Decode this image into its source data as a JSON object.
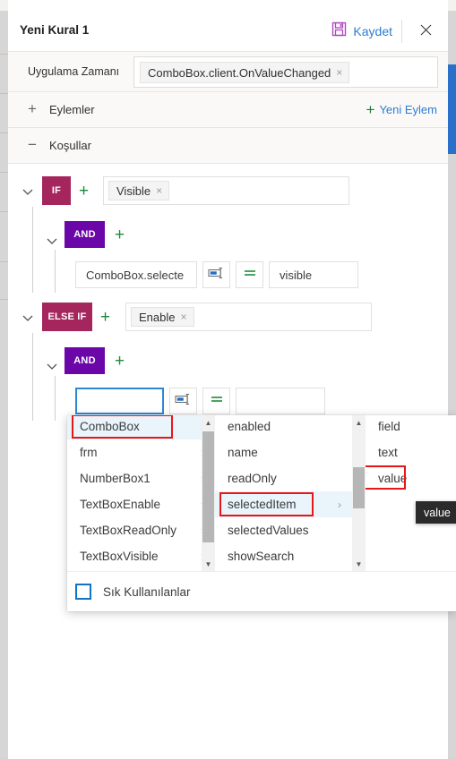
{
  "header": {
    "title": "Yeni Kural 1",
    "save_label": "Kaydet",
    "save_icon": "save-floppy-icon",
    "close_icon": "close-icon"
  },
  "trigger": {
    "label": "Uygulama Zamanı",
    "pill": "ComboBox.client.OnValueChanged",
    "pill_remove": "×"
  },
  "sections": {
    "actions": {
      "toggle": "+",
      "label": "Eylemler",
      "add_icon": "plus-icon",
      "add_label": "Yeni Eylem"
    },
    "conditions": {
      "toggle": "−",
      "label": "Koşullar"
    }
  },
  "conditions": {
    "branches": [
      {
        "badge": "IF",
        "badge_color": "#a4265c",
        "add": "+",
        "pill": "Visible",
        "pill_remove": "×",
        "group": {
          "badge": "AND",
          "badge_color": "#6b07a8",
          "add": "+",
          "rows": [
            {
              "left": "ComboBox.selecte",
              "op_icon": "textfield-cursor-icon",
              "comparator": "=",
              "right": "visible",
              "focused": false
            }
          ]
        }
      },
      {
        "badge": "ELSE IF",
        "badge_color": "#a4265c",
        "add": "+",
        "pill": "Enable",
        "pill_remove": "×",
        "group": {
          "badge": "AND",
          "badge_color": "#6b07a8",
          "add": "+",
          "rows": [
            {
              "left": "",
              "op_icon": "textfield-cursor-icon",
              "comparator": "=",
              "right": "",
              "focused": true
            }
          ]
        }
      }
    ]
  },
  "flyout": {
    "column1": {
      "options": [
        {
          "label": "ComboBox",
          "arrow": "›",
          "selected": true,
          "highlighted": true
        },
        {
          "label": "frm",
          "arrow": "›",
          "selected": false,
          "highlighted": false
        },
        {
          "label": "NumberBox1",
          "arrow": "›",
          "selected": false,
          "highlighted": false
        },
        {
          "label": "TextBoxEnable",
          "arrow": "›",
          "selected": false,
          "highlighted": false
        },
        {
          "label": "TextBoxReadOnly",
          "arrow": "›",
          "selected": false,
          "highlighted": false
        },
        {
          "label": "TextBoxVisible",
          "arrow": "›",
          "selected": false,
          "highlighted": false
        }
      ]
    },
    "column2": {
      "options": [
        {
          "label": "enabled",
          "arrow": "",
          "selected": false,
          "highlighted": false
        },
        {
          "label": "name",
          "arrow": "",
          "selected": false,
          "highlighted": false
        },
        {
          "label": "readOnly",
          "arrow": "",
          "selected": false,
          "highlighted": false
        },
        {
          "label": "selectedItem",
          "arrow": "›",
          "selected": true,
          "highlighted": true
        },
        {
          "label": "selectedValues",
          "arrow": "",
          "selected": false,
          "highlighted": false
        },
        {
          "label": "showSearch",
          "arrow": "",
          "selected": false,
          "highlighted": false
        }
      ]
    },
    "column3": {
      "options": [
        {
          "label": "field",
          "arrow": "",
          "selected": false,
          "highlighted": false
        },
        {
          "label": "text",
          "arrow": "",
          "selected": false,
          "highlighted": false
        },
        {
          "label": "value",
          "arrow": "",
          "selected": false,
          "highlighted": true
        }
      ]
    },
    "favorites_label": "Sık Kullanılanlar",
    "scroll_up": "▲",
    "scroll_down": "▼"
  },
  "tooltip": {
    "text": "value"
  },
  "colors": {
    "if_badge": "#a4265c",
    "and_badge": "#6b07a8",
    "link": "#2b7cd3",
    "green": "#1f8a3b",
    "highlight_box": "#e81717",
    "focus_border": "#2b88d8",
    "selected_row": "#e9f4fb",
    "tooltip_bg": "#2b2b2b"
  }
}
